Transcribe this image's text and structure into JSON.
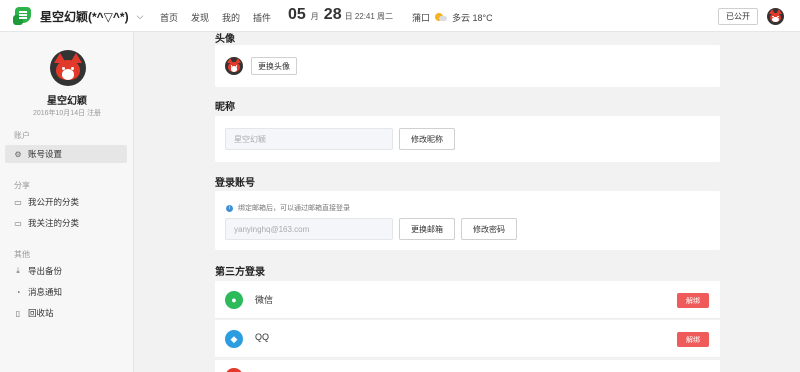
{
  "topbar": {
    "brand_title": "星空幻颖(*^▽^*)",
    "caret": "⌵",
    "nav": [
      "首页",
      "发现",
      "我的",
      "插件"
    ],
    "date_day1": "05",
    "date_month_label": "月",
    "date_day2": "28",
    "date_time": "日 22:41 周二",
    "city": "蒲口",
    "weather": "多云 18°C",
    "public_label": "已公开"
  },
  "sidebar": {
    "name": "星空幻颖",
    "registered": "2016年10月14日 注册",
    "sections": [
      {
        "title": "账户",
        "items": [
          {
            "icon": "⚙",
            "label": "账号设置"
          }
        ]
      },
      {
        "title": "分享",
        "items": [
          {
            "icon": "▭",
            "label": "我公开的分类"
          },
          {
            "icon": "▭",
            "label": "我关注的分类"
          }
        ]
      },
      {
        "title": "其他",
        "items": [
          {
            "icon": "⤓",
            "label": "导出备份"
          },
          {
            "icon": "◔",
            "label": "消息通知"
          },
          {
            "icon": "▯",
            "label": "回收站"
          }
        ]
      }
    ]
  },
  "main": {
    "avatar_title": "头像",
    "change_avatar": "更换头像",
    "nickname_title": "昵称",
    "nickname_value": "星空幻颖",
    "edit_nickname": "修改昵称",
    "login_title": "登录账号",
    "hint_icon": "i",
    "hint": "绑定邮箱后，可以通过邮箱直接登录",
    "email_value": "yanyinghq@163.com",
    "change_email": "更换邮箱",
    "change_password": "修改密码",
    "third_title": "第三方登录",
    "third": [
      {
        "label": "微信",
        "icon": "wechat-icon",
        "glyph": "●",
        "color": "#2dba5a",
        "action": "解绑"
      },
      {
        "label": "QQ",
        "icon": "qq-icon",
        "glyph": "◆",
        "color": "#2c9ee0",
        "action": "解绑"
      }
    ]
  },
  "colors": {
    "accent_green": "#2cb34a",
    "unbind_red": "#ef5b5b",
    "qq_blue": "#2c9ee0"
  }
}
